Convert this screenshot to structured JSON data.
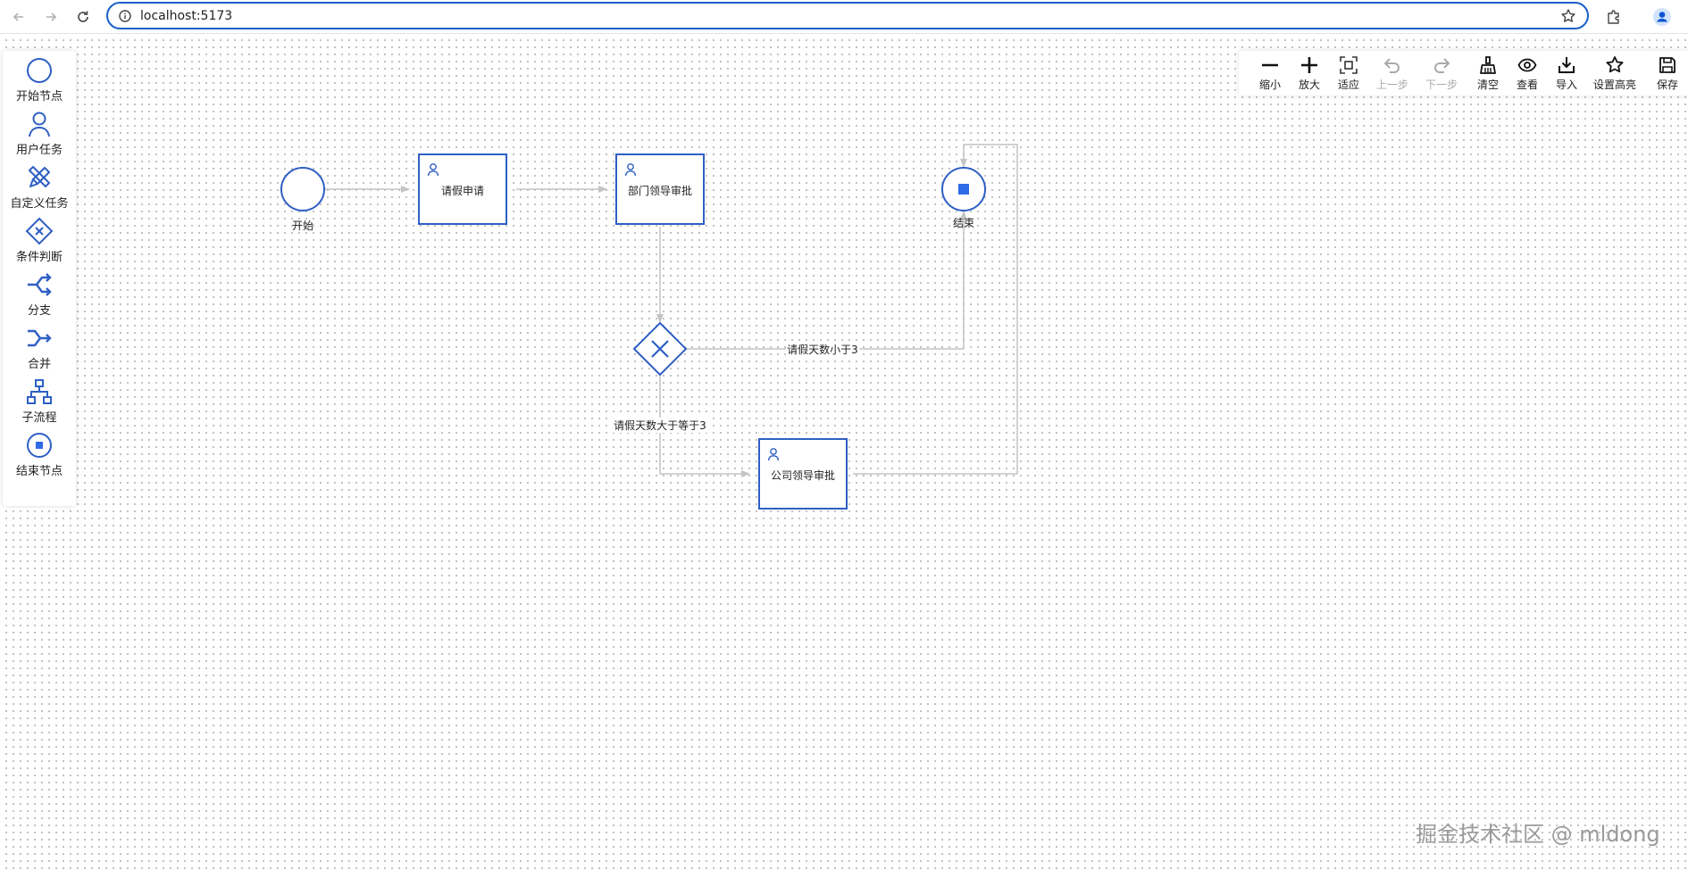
{
  "browser": {
    "url": "localhost:5173",
    "back_icon": "arrow-left-icon",
    "forward_icon": "arrow-right-icon",
    "reload_icon": "reload-icon",
    "info_icon": "info-icon",
    "bookmark_icon": "star-icon",
    "extensions_icon": "puzzle-icon",
    "profile_icon": "person-icon"
  },
  "palette": {
    "items": [
      {
        "label": "开始节点",
        "icon": "start-event-icon"
      },
      {
        "label": "用户任务",
        "icon": "user-task-icon"
      },
      {
        "label": "自定义任务",
        "icon": "custom-task-icon"
      },
      {
        "label": "条件判断",
        "icon": "gateway-icon"
      },
      {
        "label": "分支",
        "icon": "fork-icon"
      },
      {
        "label": "合并",
        "icon": "join-icon"
      },
      {
        "label": "子流程",
        "icon": "subprocess-icon"
      },
      {
        "label": "结束节点",
        "icon": "end-event-icon"
      }
    ]
  },
  "toolbar": {
    "items": [
      {
        "label": "缩小",
        "icon": "zoom-out-icon",
        "enabled": true
      },
      {
        "label": "放大",
        "icon": "zoom-in-icon",
        "enabled": true
      },
      {
        "label": "适应",
        "icon": "fit-icon",
        "enabled": true
      },
      {
        "label": "上一步",
        "icon": "undo-icon",
        "enabled": false
      },
      {
        "label": "下一步",
        "icon": "redo-icon",
        "enabled": false
      },
      {
        "label": "清空",
        "icon": "clear-icon",
        "enabled": true
      },
      {
        "label": "查看",
        "icon": "eye-icon",
        "enabled": true
      },
      {
        "label": "导入",
        "icon": "import-icon",
        "enabled": true
      },
      {
        "label": "设置高亮",
        "icon": "highlight-star-icon",
        "enabled": true
      },
      {
        "label": "保存",
        "icon": "save-icon",
        "enabled": true
      }
    ]
  },
  "diagram": {
    "start_label": "开始",
    "end_label": "结束",
    "task_leave_request": "请假申请",
    "task_dept_approval": "部门领导审批",
    "task_company_approval": "公司领导审批",
    "edge_less_than_3": "请假天数小于3",
    "edge_ge_3": "请假天数大于等于3"
  },
  "colors": {
    "primary": "#2e5fc4",
    "edge": "#c4c4c4",
    "end_fill": "#2e6be6",
    "omnibox_border": "#1a5fc8"
  },
  "watermark": "掘金技术社区 @ mldong"
}
